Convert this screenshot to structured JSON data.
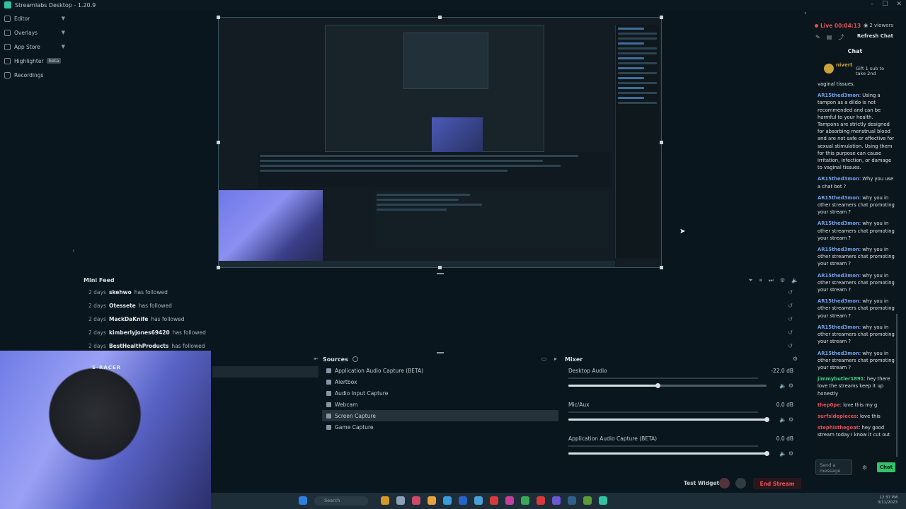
{
  "app": {
    "title": "Streamlabs Desktop - 1.20.9"
  },
  "sidebar": {
    "items": [
      {
        "label": "Editor",
        "has_chevron": true,
        "icon": "editor-icon"
      },
      {
        "label": "Overlays",
        "has_chevron": true,
        "icon": "overlays-icon"
      },
      {
        "label": "App Store",
        "has_chevron": true,
        "icon": "app-store-icon"
      },
      {
        "label": "Highlighter",
        "badge": "beta",
        "icon": "highlighter-icon"
      },
      {
        "label": "Recordings",
        "icon": "recordings-icon"
      }
    ]
  },
  "minifeed": {
    "title": "Mini Feed",
    "rows": [
      {
        "when": "2 days",
        "who": "skehwo",
        "action": "has followed"
      },
      {
        "when": "2 days",
        "who": "Otessete",
        "action": "has followed"
      },
      {
        "when": "2 days",
        "who": "MackDaKnife",
        "action": "has followed"
      },
      {
        "when": "2 days",
        "who": "kimberlyjones69420",
        "action": "has followed"
      },
      {
        "when": "2 days",
        "who": "BestHealthProducts",
        "action": "has followed"
      }
    ]
  },
  "sources": {
    "title": "Sources",
    "items": [
      {
        "label": "Application Audio Capture (BETA)",
        "selected": false
      },
      {
        "label": "Alertbox",
        "selected": false
      },
      {
        "label": "Audio Input Capture",
        "selected": false
      },
      {
        "label": "Webcam",
        "selected": false
      },
      {
        "label": "Screen Capture",
        "selected": true
      },
      {
        "label": "Game Capture",
        "selected": false
      }
    ]
  },
  "mixer": {
    "title": "Mixer",
    "channels": [
      {
        "name": "Desktop Audio",
        "db": "-22.0 dB",
        "level": 0.45
      },
      {
        "name": "Mic/Aux",
        "db": "0.0 dB",
        "level": 1.0
      },
      {
        "name": "Application Audio Capture (BETA)",
        "db": "0.0 dB",
        "level": 1.0
      }
    ]
  },
  "statusbar": {
    "test_widgets": "Test Widgets",
    "end_stream": "End Stream"
  },
  "taskbar": {
    "search": "Search",
    "time": "12:37 PM",
    "date": "3/11/2023"
  },
  "webcam": {
    "cap_text": "S-RACER"
  },
  "chat": {
    "live": "Live 00:04:13",
    "viewers": "2 viewers",
    "refresh": "Refresh Chat",
    "title": "Chat",
    "pinned_user": "nivert",
    "pinned_gift": "Gift 1 sub to take 2nd",
    "send_placeholder": "Send a message",
    "chat_button": "Chat",
    "top_fragment": "vaginal tissues.",
    "messages": [
      {
        "user": "AR15thed3mon",
        "color": "#6fa0e8",
        "text": "Using a tampon as a dildo is not recommended and can be harmful to your health. Tampons are strictly designed for absorbing menstrual blood and are not safe or effective for sexual stimulation. Using them for this purpose can cause irritation, infection, or damage to vaginal tissues."
      },
      {
        "user": "AR15thed3mon",
        "color": "#6fa0e8",
        "text": "Why you use a chat bot ?"
      },
      {
        "user": "AR15thed3mon",
        "color": "#6fa0e8",
        "text": "why you in other streamers chat promoting your stream ?"
      },
      {
        "user": "AR15thed3mon",
        "color": "#6fa0e8",
        "text": "why you in other streamers chat promoting your stream ?"
      },
      {
        "user": "AR15thed3mon",
        "color": "#6fa0e8",
        "text": "why you in other streamers chat promoting your stream ?"
      },
      {
        "user": "AR15thed3mon",
        "color": "#6fa0e8",
        "text": "why you in other streamers chat promoting your stream ?"
      },
      {
        "user": "AR15thed3mon",
        "color": "#6fa0e8",
        "text": "why you in other streamers chat promoting your stream ?"
      },
      {
        "user": "AR15thed3mon",
        "color": "#6fa0e8",
        "text": "why you in other streamers chat promoting your stream ?"
      },
      {
        "user": "AR15thed3mon",
        "color": "#6fa0e8",
        "text": "why you in other streamers chat promoting your stream ?"
      },
      {
        "user": "jimmybutler1891",
        "color": "#3fcf8a",
        "text": "hey there love the streams keep it up honestly"
      },
      {
        "user": "thep0pe",
        "color": "#e0515d",
        "text": "love this my g"
      },
      {
        "user": "surfsidepieces",
        "color": "#e0515d",
        "text": "love this"
      },
      {
        "user": "stephisthegoat",
        "color": "#e0515d",
        "text": "hey good stream today I know it cut out"
      }
    ]
  },
  "colors": {
    "accent": "#31c3a2",
    "live": "#e04e56",
    "chat_button": "#31c36b"
  }
}
